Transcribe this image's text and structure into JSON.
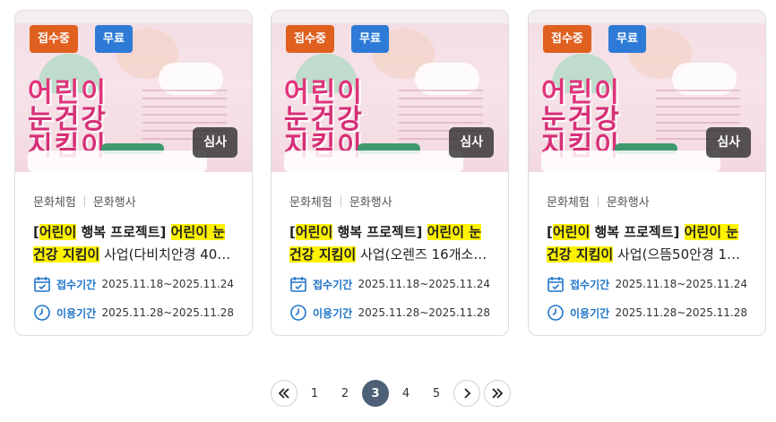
{
  "cards": [
    {
      "badges": {
        "status": "접수중",
        "price": "무료",
        "review": "심사"
      },
      "poster": {
        "line1": "어린이",
        "line2": "눈건강",
        "line3": "지킴이"
      },
      "categories": [
        "문화체험",
        "문화행사"
      ],
      "title": {
        "bracket_open": "[",
        "hl1": "어린이",
        "mid1": " 행복 프로젝트] ",
        "hl2": "어린이 눈",
        "mid2": " ",
        "hl3": "건강 지킴이",
        "rest": " 사업(다비치안경 40…"
      },
      "apply": {
        "label": "접수기간",
        "value": "2025.11.18~2025.11.24"
      },
      "use": {
        "label": "이용기간",
        "value": "2025.11.28~2025.11.28"
      }
    },
    {
      "badges": {
        "status": "접수중",
        "price": "무료",
        "review": "심사"
      },
      "poster": {
        "line1": "어린이",
        "line2": "눈건강",
        "line3": "지킴이"
      },
      "categories": [
        "문화체험",
        "문화행사"
      ],
      "title": {
        "bracket_open": "[",
        "hl1": "어린이",
        "mid1": " 행복 프로젝트] ",
        "hl2": "어린이 눈",
        "mid2": " ",
        "hl3": "건강 지킴이",
        "rest": " 사업(오렌즈 16개소…"
      },
      "apply": {
        "label": "접수기간",
        "value": "2025.11.18~2025.11.24"
      },
      "use": {
        "label": "이용기간",
        "value": "2025.11.28~2025.11.28"
      }
    },
    {
      "badges": {
        "status": "접수중",
        "price": "무료",
        "review": "심사"
      },
      "poster": {
        "line1": "어린이",
        "line2": "눈건강",
        "line3": "지킴이"
      },
      "categories": [
        "문화체험",
        "문화행사"
      ],
      "title": {
        "bracket_open": "[",
        "hl1": "어린이",
        "mid1": " 행복 프로젝트] ",
        "hl2": "어린이 눈",
        "mid2": " ",
        "hl3": "건강 지킴이",
        "rest": " 사업(으뜸50안경 1…"
      },
      "apply": {
        "label": "접수기간",
        "value": "2025.11.18~2025.11.24"
      },
      "use": {
        "label": "이용기간",
        "value": "2025.11.28~2025.11.28"
      }
    }
  ],
  "pagination": {
    "first_icon": "double-chevron-left-icon",
    "pages": [
      "1",
      "2",
      "3",
      "4",
      "5"
    ],
    "current": "3",
    "next_icon": "chevron-right-icon",
    "last_icon": "double-chevron-right-icon"
  },
  "colors": {
    "status_badge": "#e0601f",
    "price_badge": "#2d7bd6",
    "highlight": "#fff200",
    "meta_label": "#1f74c9",
    "active_page": "#4d6077"
  }
}
